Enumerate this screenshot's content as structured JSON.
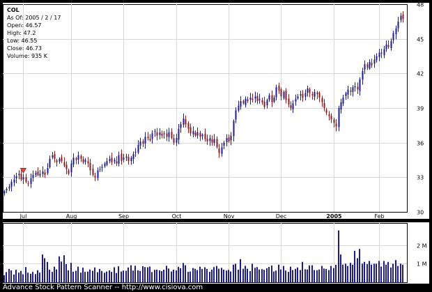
{
  "quote": {
    "symbol": "COL",
    "as_of": "As Of: 2005 / 2 / 17",
    "open": "Open: 46.57",
    "high": "High: 47.2",
    "low": "Low: 46.55",
    "close": "Close: 46.73",
    "volume": "Volume: 935 K"
  },
  "footer": {
    "text": "Advance Stock Pattern Scanner -- http://www.cisiova.com"
  },
  "colors": {
    "up": "#1a1a99",
    "down": "#8b1a1a",
    "volume": "#1a1a99",
    "marker": "#e8473f",
    "grid": "#d8d8d8"
  },
  "chart_data": [
    {
      "type": "candlestick",
      "symbol": "COL",
      "x_labels": [
        "Jul",
        "Aug",
        "Sep",
        "Oct",
        "Nov",
        "Dec",
        "2005",
        "Feb"
      ],
      "ylim": [
        30,
        48
      ],
      "y_ticks": [
        "30",
        "33",
        "36",
        "39",
        "42",
        "45",
        "48"
      ],
      "grid": true,
      "closes": [
        31.8,
        32.0,
        32.2,
        32.6,
        32.8,
        33.1,
        33.3,
        32.8,
        33.0,
        32.6,
        32.4,
        32.9,
        33.2,
        33.4,
        33.2,
        33.3,
        33.5,
        33.2,
        33.8,
        34.6,
        34.9,
        34.6,
        34.3,
        34.6,
        34.4,
        34.0,
        33.7,
        33.3,
        34.2,
        34.7,
        34.5,
        34.9,
        34.6,
        34.3,
        34.5,
        34.2,
        33.6,
        33.2,
        33.0,
        33.6,
        33.7,
        33.9,
        34.2,
        34.4,
        34.6,
        34.3,
        34.5,
        34.2,
        34.9,
        34.4,
        34.7,
        34.8,
        34.4,
        34.7,
        35.0,
        35.2,
        35.8,
        36.1,
        35.9,
        36.5,
        36.4,
        36.2,
        36.8,
        37.0,
        36.6,
        36.9,
        36.6,
        36.8,
        36.5,
        36.9,
        36.4,
        36.0,
        36.4,
        37.2,
        37.6,
        38.1,
        37.6,
        37.2,
        36.8,
        37.0,
        36.6,
        36.9,
        36.5,
        36.7,
        36.3,
        36.1,
        36.4,
        36.0,
        36.3,
        35.6,
        35.1,
        35.6,
        36.0,
        36.4,
        36.1,
        36.6,
        37.9,
        38.8,
        39.2,
        39.6,
        39.4,
        39.8,
        39.6,
        39.9,
        39.7,
        40.0,
        39.6,
        39.8,
        39.5,
        39.1,
        39.7,
        40.1,
        39.5,
        39.9,
        40.8,
        40.5,
        40.0,
        40.4,
        39.7,
        39.3,
        39.0,
        39.4,
        39.8,
        40.0,
        40.2,
        39.9,
        40.3,
        40.7,
        40.3,
        40.1,
        40.4,
        40.2,
        39.9,
        39.5,
        39.0,
        38.6,
        38.3,
        38.0,
        37.7,
        37.4,
        39.0,
        39.5,
        39.9,
        40.3,
        40.6,
        40.4,
        40.8,
        40.9,
        40.6,
        41.5,
        42.2,
        42.8,
        42.5,
        43.0,
        42.7,
        43.2,
        43.5,
        43.8,
        43.7,
        44.1,
        44.5,
        44.3,
        44.8,
        45.5,
        45.9,
        46.5,
        47.0,
        46.73
      ],
      "volume_ticks": [
        "1 M",
        "2 M"
      ],
      "volume_k": [
        380,
        550,
        720,
        640,
        420,
        680,
        520,
        610,
        430,
        820,
        520,
        460,
        560,
        440,
        650,
        520,
        1500,
        1300,
        1100,
        680,
        560,
        840,
        690,
        1400,
        1120,
        1460,
        980,
        650,
        1050,
        570,
        620,
        840,
        520,
        790,
        560,
        580,
        690,
        620,
        800,
        540,
        720,
        610,
        510,
        580,
        640,
        560,
        810,
        500,
        860,
        580,
        630,
        620,
        800,
        920,
        630,
        890,
        650,
        610,
        870,
        820,
        810,
        850,
        550,
        670,
        680,
        640,
        600,
        680,
        890,
        740,
        580,
        680,
        640,
        830,
        760,
        1040,
        920,
        560,
        580,
        770,
        730,
        660,
        840,
        720,
        810,
        720,
        560,
        680,
        820,
        880,
        730,
        780,
        680,
        630,
        670,
        580,
        950,
        1000,
        680,
        1250,
        730,
        890,
        730,
        600,
        1000,
        780,
        820,
        690,
        710,
        670,
        760,
        830,
        900,
        580,
        630,
        950,
        690,
        880,
        630,
        560,
        840,
        660,
        720,
        800,
        660,
        1100,
        700,
        690,
        910,
        920,
        660,
        650,
        690,
        880,
        740,
        720,
        660,
        880,
        770,
        940,
        2800,
        1500,
        950,
        1000,
        880,
        1050,
        950,
        1700,
        1300,
        1800,
        1000,
        1100,
        980,
        1150,
        950,
        1000,
        1000,
        1150,
        850,
        1150,
        950,
        1100,
        800,
        1000,
        1200,
        880,
        1000,
        950
      ],
      "markers": [
        {
          "index": 8,
          "kind": "signal-triangle"
        },
        {
          "index": 168,
          "kind": "signal-triangle"
        }
      ]
    }
  ]
}
